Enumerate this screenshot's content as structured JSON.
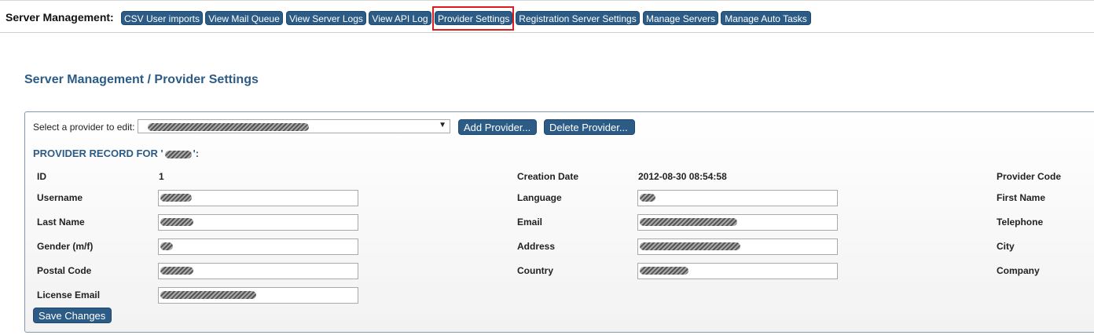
{
  "topbar": {
    "label": "Server Management:",
    "nav": [
      {
        "label": "CSV User imports"
      },
      {
        "label": "View Mail Queue"
      },
      {
        "label": "View Server Logs"
      },
      {
        "label": "View API Log"
      },
      {
        "label": "Provider Settings",
        "active": true
      },
      {
        "label": "Registration Server Settings"
      },
      {
        "label": "Manage Servers"
      },
      {
        "label": "Manage Auto Tasks"
      }
    ]
  },
  "page": {
    "title": "Server Management / Provider Settings"
  },
  "provider": {
    "select_label": "Select a provider to edit:",
    "add_label": "Add Provider...",
    "delete_label": "Delete Provider...",
    "record_title_prefix": "PROVIDER RECORD FOR '",
    "record_title_suffix": "':",
    "save_label": "Save Changes"
  },
  "fields": {
    "id": {
      "label": "ID",
      "value": "1"
    },
    "creation_date": {
      "label": "Creation Date",
      "value": "2012-08-30 08:54:58"
    },
    "provider_code": {
      "label": "Provider Code"
    },
    "username": {
      "label": "Username"
    },
    "language": {
      "label": "Language"
    },
    "first_name": {
      "label": "First Name"
    },
    "last_name": {
      "label": "Last Name"
    },
    "email": {
      "label": "Email"
    },
    "telephone": {
      "label": "Telephone"
    },
    "gender": {
      "label": "Gender (m/f)"
    },
    "address": {
      "label": "Address"
    },
    "city": {
      "label": "City"
    },
    "postal_code": {
      "label": "Postal Code"
    },
    "country": {
      "label": "Country"
    },
    "company": {
      "label": "Company"
    },
    "license_email": {
      "label": "License Email"
    }
  },
  "colors": {
    "accent": "#2c5c86",
    "highlight": "#e01b1b"
  }
}
